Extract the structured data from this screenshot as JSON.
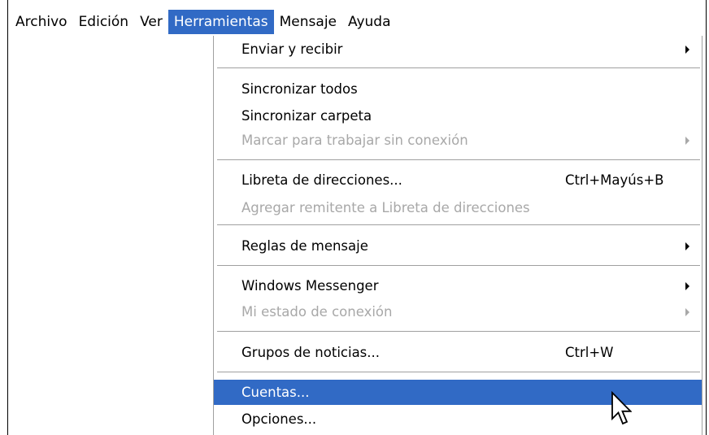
{
  "menubar": {
    "items": [
      {
        "label": "Archivo"
      },
      {
        "label": "Edición"
      },
      {
        "label": "Ver"
      },
      {
        "label": "Herramientas"
      },
      {
        "label": "Mensaje"
      },
      {
        "label": "Ayuda"
      }
    ],
    "active_index": 3
  },
  "tools_menu": {
    "items": [
      {
        "label": "Enviar y recibir",
        "submenu": true,
        "enabled": true
      },
      {
        "label": "Sincronizar todos",
        "enabled": true
      },
      {
        "label": "Sincronizar carpeta",
        "enabled": true
      },
      {
        "label": "Marcar para trabajar sin conexión",
        "submenu": true,
        "enabled": false
      },
      {
        "label": "Libreta de direcciones...",
        "shortcut": "Ctrl+Mayús+B",
        "enabled": true
      },
      {
        "label": "Agregar remitente a Libreta de direcciones",
        "enabled": false
      },
      {
        "label": "Reglas de mensaje",
        "submenu": true,
        "enabled": true
      },
      {
        "label": "Windows Messenger",
        "submenu": true,
        "enabled": true
      },
      {
        "label": "Mi estado de conexión",
        "submenu": true,
        "enabled": false
      },
      {
        "label": "Grupos de noticias...",
        "shortcut": "Ctrl+W",
        "enabled": true
      },
      {
        "label": "Cuentas...",
        "enabled": true,
        "highlighted": true
      },
      {
        "label": "Opciones...",
        "enabled": true
      }
    ]
  },
  "cursor": {
    "icon": "arrow-pointer-icon"
  },
  "colors": {
    "highlight": "#316ac5",
    "disabled_text": "#a8a8a8",
    "separator": "#a0a0a0"
  }
}
